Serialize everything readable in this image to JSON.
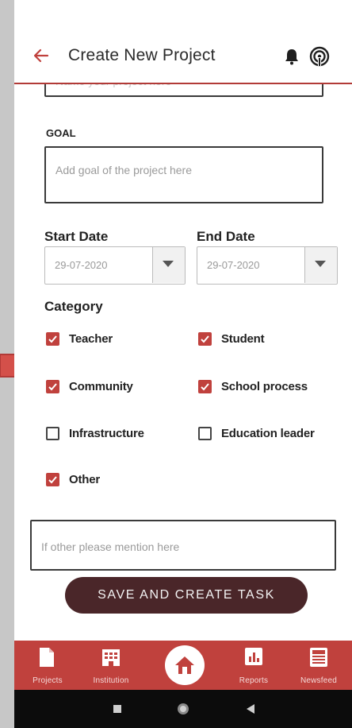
{
  "header": {
    "title": "Create New Project"
  },
  "form": {
    "previous_field_placeholder": "Name your project here",
    "goal_label": "GOAL",
    "goal_placeholder": "Add goal of the project here",
    "start_date_label": "Start Date",
    "start_date_value": "29-07-2020",
    "end_date_label": "End Date",
    "end_date_value": "29-07-2020",
    "category_label": "Category",
    "categories": [
      {
        "label": "Teacher",
        "checked": true
      },
      {
        "label": "Student",
        "checked": true
      },
      {
        "label": "Community",
        "checked": true
      },
      {
        "label": "School process",
        "checked": true
      },
      {
        "label": "Infrastructure",
        "checked": false
      },
      {
        "label": "Education leader",
        "checked": false
      },
      {
        "label": "Other",
        "checked": true
      }
    ],
    "other_placeholder": "If other please mention here",
    "save_label": "SAVE AND CREATE TASK"
  },
  "nav": {
    "items": [
      {
        "label": "Projects",
        "icon": "document-icon"
      },
      {
        "label": "Institution",
        "icon": "building-icon"
      },
      {
        "label": "",
        "icon": "home-icon"
      },
      {
        "label": "Reports",
        "icon": "bar-chart-icon"
      },
      {
        "label": "Newsfeed",
        "icon": "newspaper-icon"
      }
    ]
  },
  "colors": {
    "accent": "#c0413d",
    "button": "#4a2629",
    "background": "#c7c7c7"
  }
}
